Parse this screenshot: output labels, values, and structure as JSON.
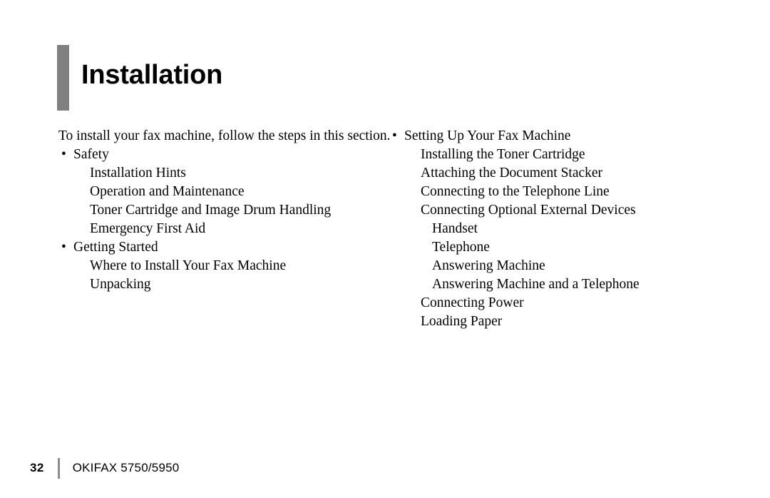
{
  "document": {
    "title": "Installation",
    "accent_color": "#808080",
    "text_color": "#000000",
    "background_color": "#ffffff"
  },
  "header": {
    "title": "Installation"
  },
  "body": {
    "intro": "To install your fax machine, follow the steps in this section.",
    "bullet_glyph": "•",
    "left_column": [
      {
        "level": 0,
        "label": "Safety"
      },
      {
        "level": 1,
        "label": "Installation Hints"
      },
      {
        "level": 1,
        "label": "Operation and Maintenance"
      },
      {
        "level": 1,
        "label": "Toner Cartridge and Image Drum Handling"
      },
      {
        "level": 1,
        "label": "Emergency First Aid"
      },
      {
        "level": 0,
        "label": "Getting Started"
      },
      {
        "level": 1,
        "label": "Where to Install Your Fax Machine"
      },
      {
        "level": 1,
        "label": "Unpacking"
      }
    ],
    "right_column": [
      {
        "level": 0,
        "label": "Setting Up Your Fax Machine"
      },
      {
        "level": 1,
        "label": "Installing the Toner Cartridge"
      },
      {
        "level": 1,
        "label": "Attaching the Document Stacker"
      },
      {
        "level": 1,
        "label": "Connecting to the Telephone Line"
      },
      {
        "level": 1,
        "label": "Connecting Optional External Devices"
      },
      {
        "level": 2,
        "label": "Handset"
      },
      {
        "level": 2,
        "label": "Telephone"
      },
      {
        "level": 2,
        "label": "Answering Machine"
      },
      {
        "level": 2,
        "label": "Answering Machine and a Telephone"
      },
      {
        "level": 1,
        "label": "Connecting Power"
      },
      {
        "level": 1,
        "label": "Loading Paper"
      }
    ]
  },
  "footer": {
    "page_number": "32",
    "product": "OKIFAX 5750/5950",
    "divider_color": "#8a8a8a"
  }
}
